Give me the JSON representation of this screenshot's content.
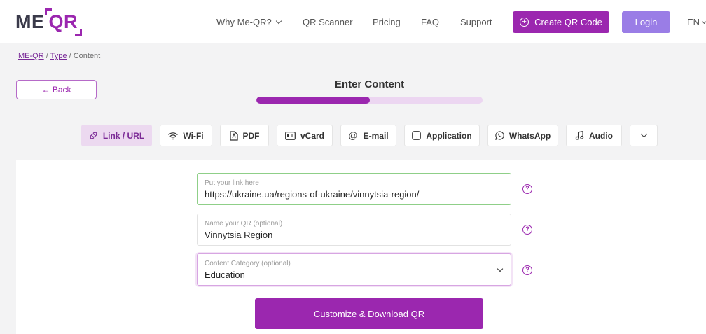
{
  "header": {
    "logo": {
      "me": "ME",
      "qr": "QR"
    },
    "nav": [
      {
        "label": "Why Me-QR?"
      },
      {
        "label": "QR Scanner"
      },
      {
        "label": "Pricing"
      },
      {
        "label": "FAQ"
      },
      {
        "label": "Support"
      }
    ],
    "create_label": "Create QR Code",
    "login_label": "Login",
    "lang_label": "EN"
  },
  "breadcrumb": {
    "home": "ME-QR",
    "type": "Type",
    "current": "Content",
    "sep": "/"
  },
  "back_label": "← Back",
  "title": "Enter Content",
  "progress": {
    "fraction": 0.5
  },
  "tabs": [
    {
      "label": "Link / URL",
      "icon": "link-icon"
    },
    {
      "label": "Wi-Fi",
      "icon": "wifi-icon"
    },
    {
      "label": "PDF",
      "icon": "pdf-icon"
    },
    {
      "label": "vCard",
      "icon": "vcard-icon"
    },
    {
      "label": "E-mail",
      "icon": "at-icon"
    },
    {
      "label": "Application",
      "icon": "app-icon"
    },
    {
      "label": "WhatsApp",
      "icon": "whatsapp-icon"
    },
    {
      "label": "Audio",
      "icon": "music-icon"
    }
  ],
  "form": {
    "link": {
      "label": "Put your link here",
      "value": "https://ukraine.ua/regions-of-ukraine/vinnytsia-region/"
    },
    "name": {
      "label": "Name your QR (optional)",
      "value": "Vinnytsia Region"
    },
    "category": {
      "label": "Content Category (optional)",
      "value": "Education"
    },
    "help_glyph": "?"
  },
  "download_label": "Customize & Download QR",
  "colors": {
    "accent": "#9b27af",
    "login": "#9a7de6",
    "active_tab_bg": "#ecd9f0"
  }
}
